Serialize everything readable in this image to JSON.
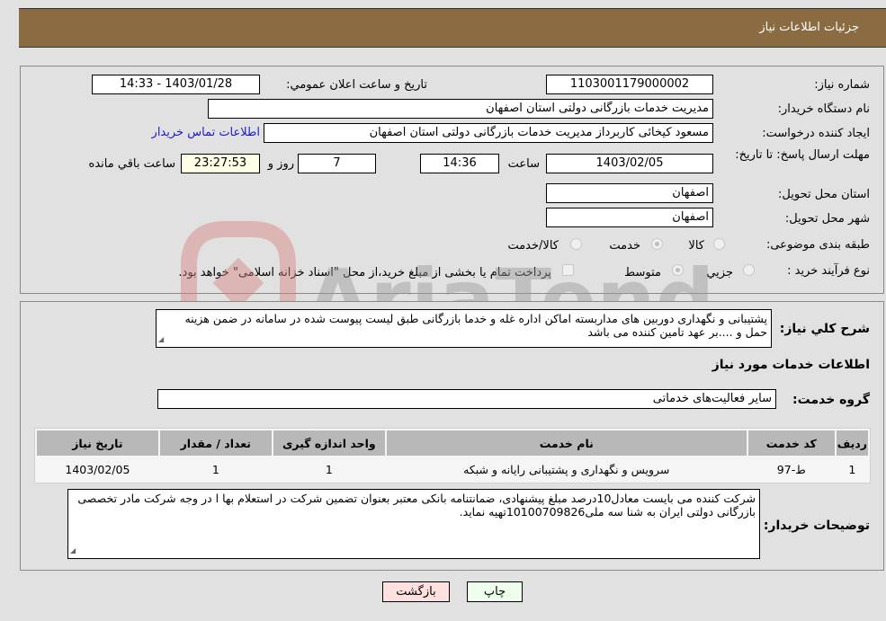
{
  "header": {
    "title": "جزئیات اطلاعات نیاز"
  },
  "form": {
    "need_number": {
      "label": "شماره نیاز:",
      "value": "1103001179000002"
    },
    "announce": {
      "label": "تاریخ و ساعت اعلان عمومي:",
      "value": "1403/01/28 - 14:33"
    },
    "buyer_org": {
      "label": "نام دستگاه خریدار:",
      "value": "مدیریت خدمات بازرگانی دولتی استان اصفهان"
    },
    "creator": {
      "label": "ایجاد کننده درخواست:",
      "value": "مسعود کیخائی کاربرداز مدیریت خدمات بازرگانی دولتی استان اصفهان"
    },
    "contact_link": "اطلاعات تماس خریدار",
    "deadline": {
      "label": "مهلت ارسال پاسخ: تا تاریخ:",
      "date": "1403/02/05",
      "time_label": "ساعت",
      "time": "14:36",
      "days": "7",
      "days_label": "روز و",
      "remaining": "23:27:53",
      "remaining_label": "ساعت باقي مانده"
    },
    "province": {
      "label": "استان محل تحویل:",
      "value": "اصفهان"
    },
    "city": {
      "label": "شهر محل تحویل:",
      "value": "اصفهان"
    },
    "category": {
      "label": "طبقه بندی موضوعی:",
      "options": [
        "کالا",
        "خدمت",
        "کالا/خدمت"
      ],
      "selected": "خدمت"
    },
    "purchase_type": {
      "label": "نوع فرآیند خرید :",
      "options": [
        "جزيي",
        "متوسط"
      ],
      "selected": "متوسط",
      "treasury_note": "پرداخت تمام یا بخشی از مبلغ خرید،از محل \"اسناد خزانه اسلامی\" خواهد بود."
    }
  },
  "details": {
    "description_label": "شرح کلي نیاز:",
    "description": "پشتیبانی و نگهداری دوربین های مداربسته اماکن اداره غله و خدما بازرگانی طبق لیست پیوست شده در سامانه در ضمن هزینه حمل و ....بر عهد تامین کننده می باشد",
    "services_heading": "اطلاعات خدمات مورد نیاز",
    "service_group_label": "گروه خدمت:",
    "service_group": "سایر فعالیت‌های خدماتی",
    "table": {
      "headers": [
        "ردیف",
        "کد خدمت",
        "نام خدمت",
        "واحد اندازه گیری",
        "تعداد / مقدار",
        "تاریخ نیاز"
      ],
      "rows": [
        [
          "1",
          "ط-97",
          "سرویس و نگهداری و پشتیبانی رایانه و شبکه",
          "1",
          "1",
          "1403/02/05"
        ]
      ]
    },
    "buyer_notes_label": "توضیحات خریدار:",
    "buyer_notes": "شرکت کننده می بایست معادل10درصد مبلغ پیشنهادی، ضمانتنامه بانکی معتبر بعنوان تضمین شرکت در استعلام بها ا در وجه شرکت مادر تخصصی بازرگانی دولتی ایران به شنا سه ملی10100709826تهیه نماید."
  },
  "buttons": {
    "print": "چاپ",
    "back": "بازگشت"
  },
  "watermark": "AriaTender.neT"
}
